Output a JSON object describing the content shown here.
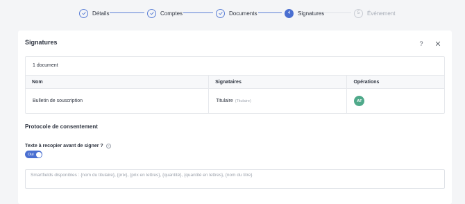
{
  "stepper": {
    "steps": [
      {
        "label": "Détails",
        "state": "done",
        "number": "1"
      },
      {
        "label": "Comptes",
        "state": "done",
        "number": "2"
      },
      {
        "label": "Documents",
        "state": "done",
        "number": "3"
      },
      {
        "label": "Signatures",
        "state": "active",
        "number": "4"
      },
      {
        "label": "Événement",
        "state": "pending",
        "number": "5"
      }
    ]
  },
  "card": {
    "title": "Signatures",
    "help_symbol": "?"
  },
  "documents": {
    "count_label": "1 document",
    "columns": [
      "Nom",
      "Signataires",
      "Opérations"
    ],
    "rows": [
      {
        "name": "Bulletin de souscription",
        "signer": "Titulaire",
        "signer_role": "(Titulaire)",
        "avatar": "AF"
      }
    ]
  },
  "consent": {
    "section_title": "Protocole de consentement",
    "field_label": "Texte à recopier avant de signer ?",
    "help_symbol": "?",
    "toggle_label": "Oui",
    "toggle_on": true,
    "textarea_placeholder": "Smartfields disponibles : {nom du titulaire}, {prix}, {prix en lettres}, {quantité}, {quantité en lettres}, {nom du titre}"
  },
  "colors": {
    "accent": "#4a6fd1",
    "avatar": "#4fa98a"
  }
}
